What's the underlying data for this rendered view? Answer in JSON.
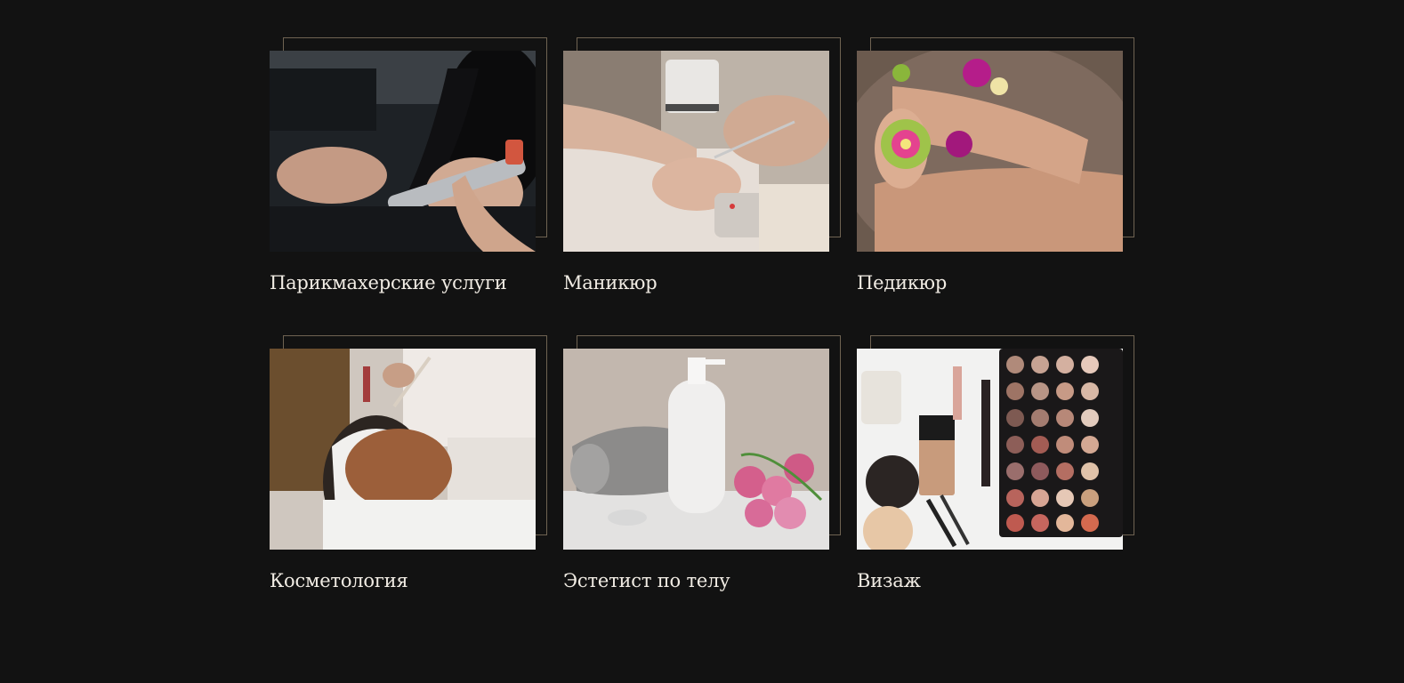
{
  "services": [
    {
      "label": "Парикмахерские услуги",
      "image": "hair-styling-photo"
    },
    {
      "label": "Маникюр",
      "image": "manicure-photo"
    },
    {
      "label": "Педикюр",
      "image": "pedicure-photo"
    },
    {
      "label": "Косметология",
      "image": "cosmetology-photo"
    },
    {
      "label": "Эстетист по телу",
      "image": "body-esthetics-photo"
    },
    {
      "label": "Визаж",
      "image": "makeup-photo"
    }
  ],
  "colors": {
    "background": "#121212",
    "frame": "#6f6352",
    "text": "#f1ece4"
  }
}
